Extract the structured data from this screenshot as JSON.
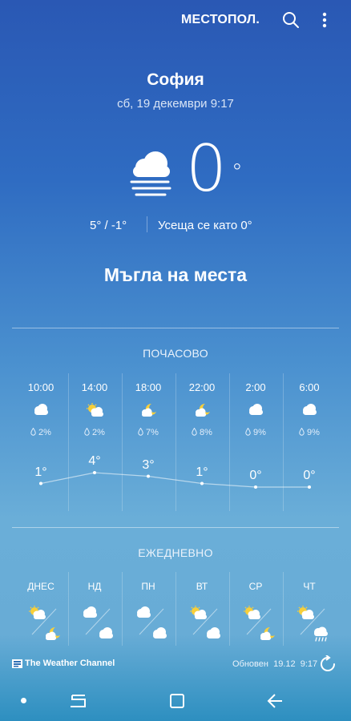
{
  "header": {
    "location_label": "МЕСТОПОЛ."
  },
  "current": {
    "city": "София",
    "datetime": "сб, 19 декември 9:17",
    "temp": "0",
    "degree": "°",
    "min_max": "5° / -1°",
    "feels_like": "Усеща се като 0°",
    "condition": "Мъгла на места"
  },
  "hourly": {
    "title": "ПОЧАСОВО",
    "items": [
      {
        "time": "10:00",
        "icon": "cloud-icon",
        "rain": "2%",
        "temp": "1°"
      },
      {
        "time": "14:00",
        "icon": "partly-sunny-icon",
        "rain": "2%",
        "temp": "4°"
      },
      {
        "time": "18:00",
        "icon": "moon-cloud-icon",
        "rain": "7%",
        "temp": "3°"
      },
      {
        "time": "22:00",
        "icon": "moon-cloud-icon",
        "rain": "8%",
        "temp": "1°"
      },
      {
        "time": "2:00",
        "icon": "cloud-icon",
        "rain": "9%",
        "temp": "0°"
      },
      {
        "time": "6:00",
        "icon": "cloud-icon",
        "rain": "9%",
        "temp": "0°"
      }
    ]
  },
  "daily": {
    "title": "ЕЖЕДНЕВНО",
    "items": [
      {
        "day": "ДНЕС",
        "day_icon": "partly-sunny-icon",
        "night_icon": "moon-cloud-icon"
      },
      {
        "day": "НД",
        "day_icon": "cloud-icon",
        "night_icon": "cloud-icon"
      },
      {
        "day": "ПН",
        "day_icon": "cloud-icon",
        "night_icon": "cloud-icon"
      },
      {
        "day": "ВТ",
        "day_icon": "partly-sunny-icon",
        "night_icon": "cloud-icon"
      },
      {
        "day": "СР",
        "day_icon": "partly-sunny-icon",
        "night_icon": "moon-cloud-icon"
      },
      {
        "day": "ЧТ",
        "day_icon": "partly-sunny-icon",
        "night_icon": "rain-icon"
      }
    ]
  },
  "footer": {
    "brand": "The Weather Channel",
    "updated_label": "Обновен",
    "updated_date": "19.12",
    "updated_time": "9:17"
  },
  "colors": {
    "bg_top": "#2a58b4",
    "bg_bottom": "#2d8fc0",
    "sun": "#f7cf3a"
  }
}
